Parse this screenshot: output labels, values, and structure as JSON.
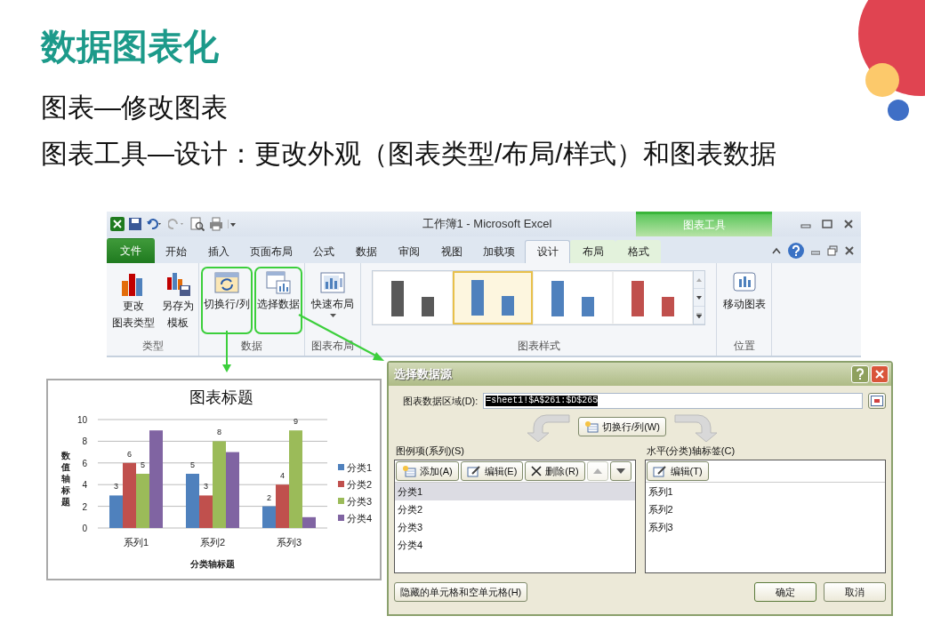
{
  "slide": {
    "title": "数据图表化",
    "lines": [
      "图表—修改图表",
      "图表工具—设计：更改外观（图表类型/布局/样式）和图表数据"
    ]
  },
  "excel": {
    "title": "工作簿1  -  Microsoft Excel",
    "context_label": "图表工具",
    "tabs": [
      {
        "label": "文件",
        "kind": "file",
        "selected": false,
        "contextual": false
      },
      {
        "label": "开始",
        "kind": "tab",
        "selected": false,
        "contextual": false
      },
      {
        "label": "插入",
        "kind": "tab",
        "selected": false,
        "contextual": false
      },
      {
        "label": "页面布局",
        "kind": "tab",
        "selected": false,
        "contextual": false
      },
      {
        "label": "公式",
        "kind": "tab",
        "selected": false,
        "contextual": false
      },
      {
        "label": "数据",
        "kind": "tab",
        "selected": false,
        "contextual": false
      },
      {
        "label": "审阅",
        "kind": "tab",
        "selected": false,
        "contextual": false
      },
      {
        "label": "视图",
        "kind": "tab",
        "selected": false,
        "contextual": false
      },
      {
        "label": "加载项",
        "kind": "tab",
        "selected": false,
        "contextual": false
      },
      {
        "label": "设计",
        "kind": "tab",
        "selected": true,
        "contextual": true
      },
      {
        "label": "布局",
        "kind": "tab",
        "selected": false,
        "contextual": true
      },
      {
        "label": "格式",
        "kind": "tab",
        "selected": false,
        "contextual": true
      }
    ],
    "groups": [
      {
        "label": "类型",
        "kind": "buttons",
        "buttons": [
          {
            "lines": [
              "更改",
              "图表类型"
            ],
            "kind": "change-type",
            "highlighted": false,
            "dropdown": false
          },
          {
            "lines": [
              "另存为",
              "模板"
            ],
            "kind": "save-template",
            "highlighted": false,
            "dropdown": false
          }
        ]
      },
      {
        "label": "数据",
        "kind": "buttons",
        "buttons": [
          {
            "lines": [
              "切换行/列"
            ],
            "kind": "switch",
            "highlighted": true,
            "dropdown": false
          },
          {
            "lines": [
              "选择数据"
            ],
            "kind": "select",
            "highlighted": true,
            "dropdown": false
          }
        ]
      },
      {
        "label": "图表布局",
        "kind": "buttons",
        "buttons": [
          {
            "lines": [
              "快速布局"
            ],
            "kind": "quick-layout",
            "highlighted": false,
            "dropdown": true
          }
        ]
      },
      {
        "label": "图表样式",
        "kind": "gallery",
        "styles": [
          {
            "color": "#595959",
            "selected": false
          },
          {
            "color": "#4f81bd",
            "selected": true
          },
          {
            "color": "#4f81bd",
            "selected": false
          },
          {
            "color": "#c0504d",
            "selected": false
          }
        ]
      },
      {
        "label": "位置",
        "kind": "buttons",
        "buttons": [
          {
            "lines": [
              "移动图表"
            ],
            "kind": "move",
            "highlighted": false,
            "dropdown": false
          }
        ]
      }
    ]
  },
  "chart": {
    "chart_data": {
      "type": "bar",
      "title": "图表标题",
      "xlabel": "分类轴标题",
      "ylabel": "数值轴标题",
      "categories": [
        "系列1",
        "系列2",
        "系列3"
      ],
      "series": [
        {
          "name": "分类1",
          "color": "#4f81bd",
          "values": [
            3,
            5,
            2
          ],
          "data_labels": true
        },
        {
          "name": "分类2",
          "color": "#c0504d",
          "values": [
            6,
            3,
            4
          ],
          "data_labels": true
        },
        {
          "name": "分类3",
          "color": "#9bbb59",
          "values": [
            5,
            8,
            9
          ],
          "data_labels": true
        },
        {
          "name": "分类4",
          "color": "#8064a2",
          "values": [
            9,
            7,
            1
          ],
          "data_labels": false
        }
      ],
      "ylim": [
        0,
        10
      ],
      "yticks": [
        0,
        2,
        4,
        6,
        8,
        10
      ],
      "grid": true,
      "legend": true
    }
  },
  "dialog": {
    "title": "选择数据源",
    "range_label": "图表数据区域(D):",
    "range_value": "=sheet1!$A$261:$D$265",
    "switch_button": "切换行/列(W)",
    "legend_panel": {
      "label": "图例项(系列)(S)",
      "buttons": [
        {
          "label": "添加(A)",
          "kind": "add",
          "disabled": false
        },
        {
          "label": "编辑(E)",
          "kind": "edit",
          "disabled": false
        },
        {
          "label": "删除(R)",
          "kind": "delete",
          "disabled": false
        },
        {
          "kind": "up",
          "disabled": true
        },
        {
          "kind": "down",
          "disabled": false
        }
      ],
      "items": [
        {
          "label": "分类1",
          "selected": true
        },
        {
          "label": "分类2",
          "selected": false
        },
        {
          "label": "分类3",
          "selected": false
        },
        {
          "label": "分类4",
          "selected": false
        }
      ]
    },
    "axis_panel": {
      "label": "水平(分类)轴标签(C)",
      "buttons": [
        {
          "label": "编辑(T)",
          "kind": "edit",
          "disabled": false
        }
      ],
      "items": [
        {
          "label": "系列1",
          "selected": false
        },
        {
          "label": "系列2",
          "selected": false
        },
        {
          "label": "系列3",
          "selected": false
        }
      ]
    },
    "hidden_cells_button": "隐藏的单元格和空单元格(H)",
    "ok_button": "确定",
    "cancel_button": "取消"
  }
}
